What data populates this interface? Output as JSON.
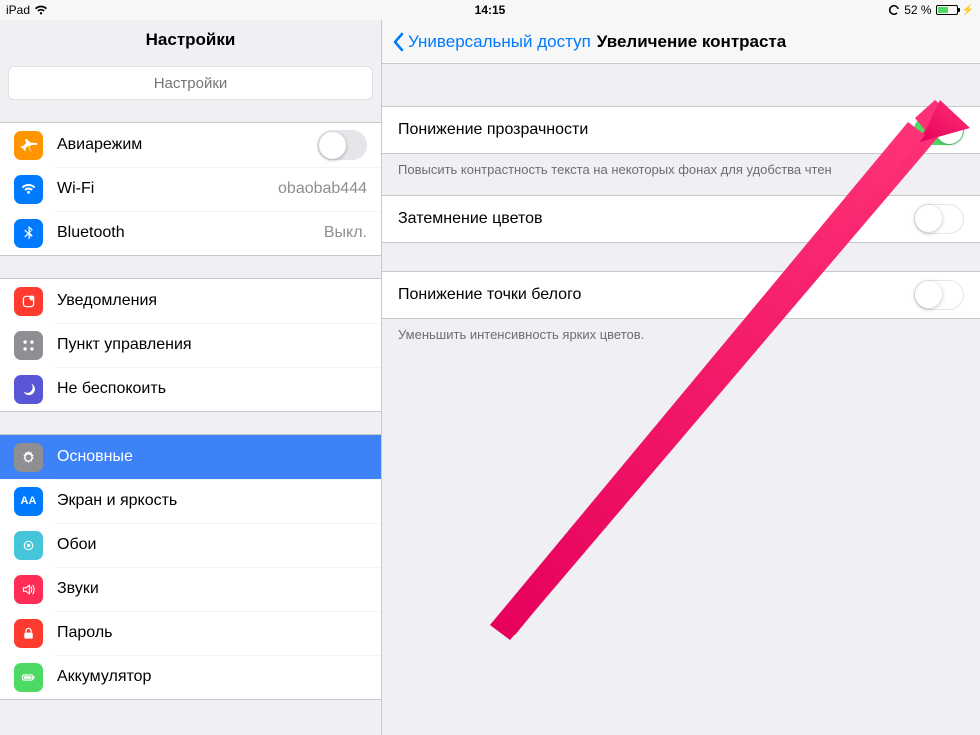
{
  "status": {
    "device": "iPad",
    "time": "14:15",
    "battery_pct": "52 %"
  },
  "sidebar": {
    "title": "Настройки",
    "search_placeholder": "Настройки",
    "groups": [
      {
        "rows": [
          {
            "icon": "airplane",
            "label": "Авиарежим",
            "switch": false
          },
          {
            "icon": "wifi",
            "label": "Wi-Fi",
            "value": "obaobab444"
          },
          {
            "icon": "bluetooth",
            "label": "Bluetooth",
            "value": "Выкл."
          }
        ]
      },
      {
        "rows": [
          {
            "icon": "notifications",
            "label": "Уведомления"
          },
          {
            "icon": "controlcenter",
            "label": "Пункт управления"
          },
          {
            "icon": "dnd",
            "label": "Не беспокоить"
          }
        ]
      },
      {
        "rows": [
          {
            "icon": "general",
            "label": "Основные",
            "selected": true
          },
          {
            "icon": "display",
            "label": "Экран и яркость"
          },
          {
            "icon": "wallpaper",
            "label": "Обои"
          },
          {
            "icon": "sounds",
            "label": "Звуки"
          },
          {
            "icon": "passcode",
            "label": "Пароль"
          },
          {
            "icon": "battery",
            "label": "Аккумулятор"
          }
        ]
      }
    ]
  },
  "detail": {
    "back_label": "Универсальный доступ",
    "title": "Увеличение контраста",
    "rows": {
      "reduce_transparency": {
        "label": "Понижение прозрачности",
        "on": true
      },
      "darken_colors": {
        "label": "Затемнение цветов",
        "on": false
      },
      "reduce_white_point": {
        "label": "Понижение точки белого",
        "on": false
      }
    },
    "captions": {
      "transparency": "Повысить контрастность текста на некоторых фонах для удобства чтен",
      "white_point": "Уменьшить интенсивность ярких цветов."
    }
  }
}
